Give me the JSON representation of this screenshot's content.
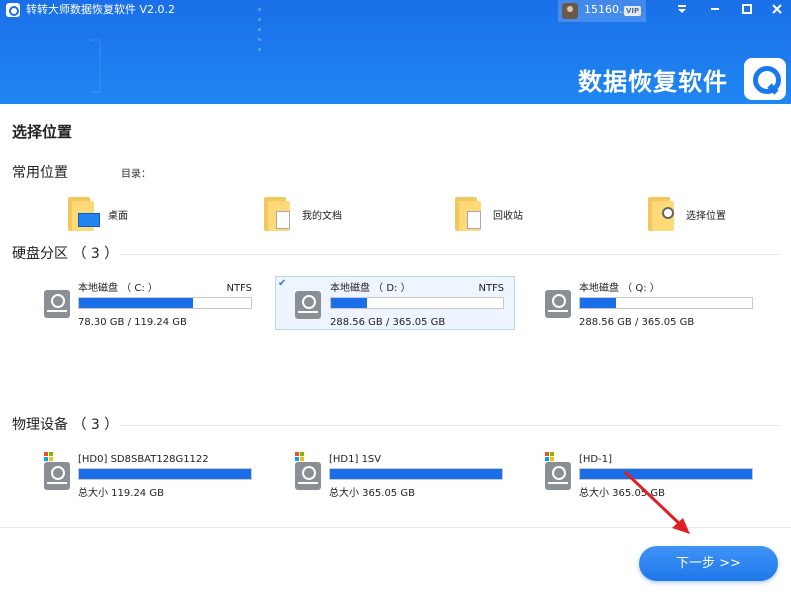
{
  "window": {
    "title": "转转大师数据恢复软件 V2.0.2",
    "user_id": "15160...",
    "vip_badge": "VIP",
    "controls": [
      "dropdown-icon",
      "minimize-icon",
      "maximize-icon",
      "close-icon"
    ]
  },
  "banner": {
    "title": "数据恢复软件"
  },
  "page_title": "选择位置",
  "common": {
    "title": "常用位置",
    "dir_label": "目录：",
    "items": [
      {
        "label": "桌面",
        "icon": "desktop-folder-icon"
      },
      {
        "label": "我的文档",
        "icon": "documents-folder-icon"
      },
      {
        "label": "回收站",
        "icon": "recycle-bin-folder-icon"
      },
      {
        "label": "选择位置",
        "icon": "search-folder-icon"
      }
    ]
  },
  "partitions": {
    "title": "硬盘分区 （ 3 ）",
    "items": [
      {
        "name": "本地磁盘 （ C: ）",
        "fs": "NTFS",
        "size": "78.30 GB / 119.24 GB",
        "used_fraction": 0.66,
        "selected": false
      },
      {
        "name": "本地磁盘 （ D: ）",
        "fs": "NTFS",
        "size": "288.56 GB / 365.05 GB",
        "used_fraction": 0.21,
        "selected": true
      },
      {
        "name": "本地磁盘 （ Q: ）",
        "fs": "",
        "size": "288.56 GB / 365.05 GB",
        "used_fraction": 0.21,
        "selected": false
      }
    ]
  },
  "devices": {
    "title": "物理设备 （ 3 ）",
    "items": [
      {
        "name": "[HD0] SD8SBAT128G1122",
        "size": "总大小 119.24 GB",
        "used_fraction": 1.0
      },
      {
        "name": "[HD1] 1SV",
        "size": "总大小 365.05 GB",
        "used_fraction": 1.0
      },
      {
        "name": "[HD-1]",
        "size": "总大小 365.05 GB",
        "used_fraction": 1.0
      }
    ]
  },
  "next_button": "下一步 >>",
  "colors": {
    "accent": "#1a6fe8",
    "arrow": "#e02020"
  }
}
